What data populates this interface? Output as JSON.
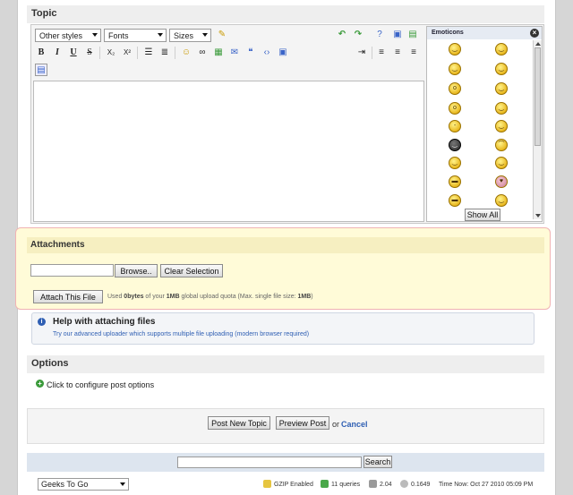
{
  "topic": {
    "title": "Topic"
  },
  "editor": {
    "style_select": "Other styles",
    "font_select": "Fonts",
    "size_select": "Sizes",
    "emoticons_title": "Emoticons",
    "show_all": "Show All"
  },
  "attachments": {
    "title": "Attachments",
    "browse": "Browse..",
    "clear": "Clear Selection",
    "attach": "Attach This File",
    "quota_used": "0bytes",
    "quota_total": "1MB",
    "quota_max": "1MB",
    "quota_prefix": "Used ",
    "quota_middle": " of your ",
    "quota_mid2": " global upload quota (Max. single file size: ",
    "quota_suffix": ")"
  },
  "help": {
    "title": "Help with attaching files",
    "link": "Try our advanced uploader which supports multiple file uploading (modern browser required)"
  },
  "options": {
    "title": "Options",
    "configure": "Click to configure post options"
  },
  "actions": {
    "post": "Post New Topic",
    "preview": "Preview Post",
    "or": "or",
    "cancel": "Cancel"
  },
  "search": {
    "button": "Search",
    "value": ""
  },
  "footer": {
    "skin": "Geeks To Go",
    "gzip": "GZIP Enabled",
    "queries": "11 queries",
    "load": "2.04",
    "time_taken": "0.1649",
    "time_now": "Time Now: Oct 27 2010 05:09 PM"
  }
}
